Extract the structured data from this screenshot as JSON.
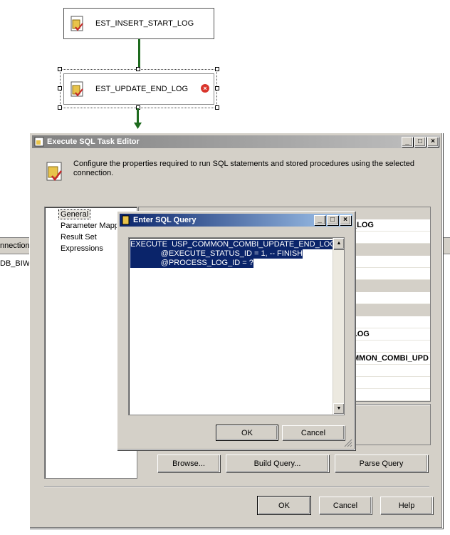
{
  "designer": {
    "task1_label": "EST_INSERT_START_LOG",
    "task2_label": "EST_UPDATE_END_LOG",
    "error_icon": "error-icon",
    "bg_column_header": "nnection",
    "bg_row_value": "DB_BIW"
  },
  "task_editor": {
    "title": "Execute SQL Task Editor",
    "description": "Configure the properties required to run SQL statements and stored procedures using the selected connection.",
    "nav_items": [
      "General",
      "Parameter Mapping",
      "Result Set",
      "Expressions"
    ],
    "grid_values": [
      "_LOG",
      "LOG",
      "MMON_COMBI_UPD"
    ],
    "buttons": {
      "browse": "Browse...",
      "build_query": "Build Query...",
      "parse_query": "Parse Query",
      "ok": "OK",
      "cancel": "Cancel",
      "help": "Help"
    },
    "title_buttons": [
      "_",
      "□",
      "×"
    ]
  },
  "sql_dialog": {
    "title": "Enter SQL Query",
    "query_lines": [
      "EXECUTE  USP_COMMON_COMBI_UPDATE_END_LOG",
      "              @EXECUTE_STATUS_ID = 1, -- FINISH",
      "              @PROCESS_LOG_ID = ?"
    ],
    "ok": "OK",
    "cancel": "Cancel",
    "title_buttons": [
      "_",
      "□",
      "×"
    ]
  },
  "colors": {
    "titlebar_active": "#0a246a",
    "titlebar_inactive": "#808080",
    "face": "#d4d0c8",
    "connector": "#1e6b1e",
    "selection": "#0a246a"
  }
}
